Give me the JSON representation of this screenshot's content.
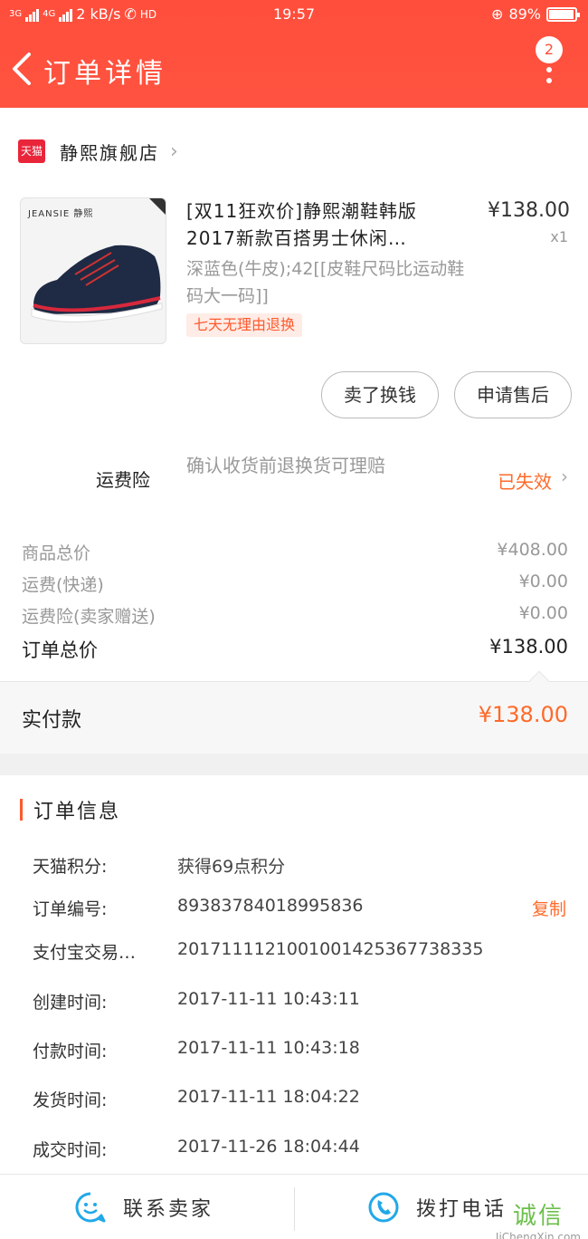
{
  "status_bar": {
    "network_left": "3G",
    "network_right": "4G",
    "speed": "2 kB/s",
    "hd": "HD",
    "time": "19:57",
    "battery": "89%",
    "battery_level": 0.89
  },
  "header": {
    "title": "订单详情",
    "badge_count": "2"
  },
  "shop": {
    "logo_text": "天猫",
    "name": "静熙旗舰店"
  },
  "product": {
    "image_brand": "JEANSIE 静熙",
    "title": "[双11狂欢价]静熙潮鞋韩版2017新款百搭男士休闲…",
    "price": "¥138.00",
    "quantity": "x1",
    "sku": "深蓝色(牛皮);42[[皮鞋尺码比运动鞋码大一码]]",
    "tag": "七天无理由退换"
  },
  "actions": {
    "buyer_button": "卖了换钱",
    "after_sales_button": "申请售后"
  },
  "insurance": {
    "label": "运费险",
    "description": "确认收货前退换货可理赔",
    "status": "已失效"
  },
  "summary": {
    "rows": [
      {
        "label": "商品总价",
        "value": "¥408.00"
      },
      {
        "label": "运费(快递)",
        "value": "¥0.00"
      },
      {
        "label": "运费险(卖家赠送)",
        "value": "¥0.00"
      }
    ],
    "total_label": "订单总价",
    "total_value": "¥138.00"
  },
  "payment": {
    "label": "实付款",
    "value": "¥138.00"
  },
  "order_info": {
    "title": "订单信息",
    "rows": [
      {
        "label": "天猫积分:",
        "value": "获得69点积分"
      },
      {
        "label": "订单编号:",
        "value": "89383784018995836"
      },
      {
        "label": "支付宝交易…",
        "value": "2017111121001001425367738335"
      },
      {
        "label": "创建时间:",
        "value": "2017-11-11 10:43:11"
      },
      {
        "label": "付款时间:",
        "value": "2017-11-11 10:43:18"
      },
      {
        "label": "发货时间:",
        "value": "2017-11-11 18:04:22"
      },
      {
        "label": "成交时间:",
        "value": "2017-11-26 18:04:44"
      }
    ],
    "copy_label": "复制"
  },
  "footer": {
    "contact_seller": "联系卖家",
    "call_phone": "拨打电话"
  },
  "watermark": {
    "text": "诚信",
    "domain": "JiChengXin.com"
  },
  "colors": {
    "header": "#ff4e3c",
    "accent": "#ff6a2a",
    "tmall": "#e9253a"
  }
}
